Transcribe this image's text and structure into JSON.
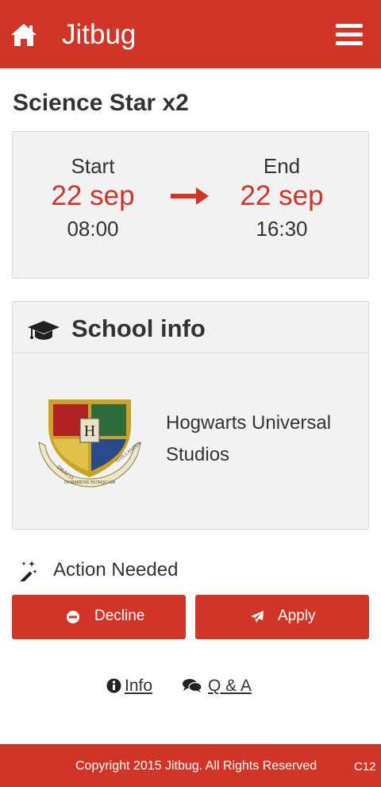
{
  "header": {
    "brand": "Jitbug",
    "home_icon": "home-icon",
    "menu_icon": "hamburger-menu-icon",
    "color": "#d03527"
  },
  "job": {
    "title": "Science Star x2"
  },
  "schedule": {
    "start": {
      "label": "Start",
      "date": "22 sep",
      "time": "08:00"
    },
    "end": {
      "label": "End",
      "date": "22 sep",
      "time": "16:30"
    },
    "accent_color": "#d03527"
  },
  "school": {
    "heading": "School info",
    "icon": "graduation-cap-icon",
    "name": "Hogwarts Universal Studios",
    "crest_text": [
      "DRACO",
      "DORMIENS NUNQUAM",
      "TITILLANDUS"
    ]
  },
  "action": {
    "label": "Action Needed",
    "icon": "magic-wand-icon"
  },
  "buttons": {
    "decline": "Decline",
    "apply": "Apply"
  },
  "links": {
    "info": "Info",
    "qa": "Q & A"
  },
  "footer": {
    "copyright": "Copyright 2015 Jitbug. All Rights Reserved",
    "code": "C12"
  }
}
